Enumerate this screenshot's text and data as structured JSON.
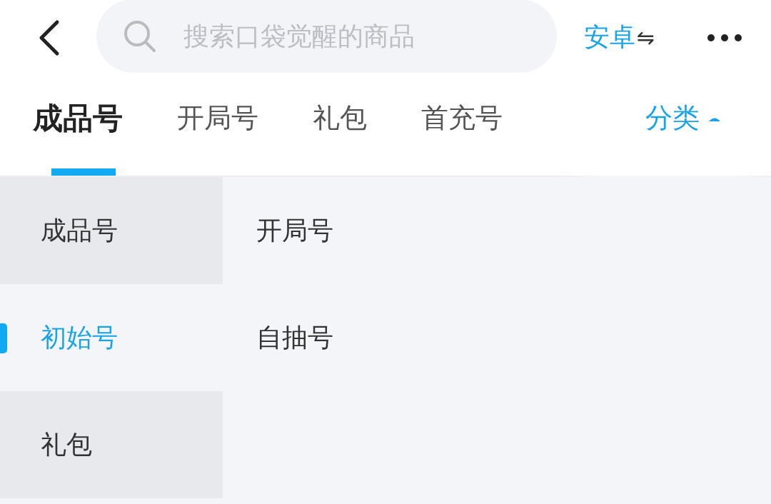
{
  "search": {
    "placeholder": "搜索口袋觉醒的商品"
  },
  "platform": {
    "label": "安卓",
    "switch_glyph": "⇋"
  },
  "tabs": [
    {
      "label": "成品号",
      "selected": true
    },
    {
      "label": "开局号",
      "selected": false
    },
    {
      "label": "礼包",
      "selected": false
    },
    {
      "label": "首充号",
      "selected": false
    }
  ],
  "category_toggle": {
    "label": "分类",
    "expanded": true
  },
  "sidebar": {
    "items": [
      {
        "label": "成品号",
        "selected": false
      },
      {
        "label": "初始号",
        "selected": true
      },
      {
        "label": "礼包",
        "selected": false
      }
    ]
  },
  "subcategories": [
    {
      "label": "开局号"
    },
    {
      "label": "自抽号"
    }
  ]
}
